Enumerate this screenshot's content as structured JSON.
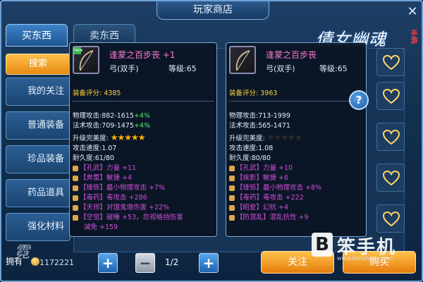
{
  "window": {
    "title": "玩家商店",
    "close_icon": "close-icon"
  },
  "logo": {
    "main": "倩女幽魂",
    "sub": "手游"
  },
  "tabs": [
    {
      "label": "买东西",
      "active": true
    },
    {
      "label": "卖东西",
      "active": false
    }
  ],
  "sidebar": {
    "search_label": "搜索",
    "items": [
      {
        "label": "我的关注"
      },
      {
        "label": "普通装备"
      },
      {
        "label": "珍品装备"
      },
      {
        "label": "药品道具"
      },
      {
        "label": "强化材料"
      }
    ]
  },
  "tooltip_left": {
    "badge": "new",
    "name": "逢蒙之百步丧 +1",
    "type": "弓(双手)",
    "level_label": "等级:65",
    "score_label": "装备评分:",
    "score": "4385",
    "phys_attack": "物理攻击:882-1615",
    "phys_bonus": "+4%",
    "magic_attack": "法术攻击:709-1475",
    "magic_bonus": "+4%",
    "perfection_label": "升级完美度:",
    "perfection_stars": 5,
    "attack_speed": "攻击速度:1.07",
    "durability": "耐久度:61/80",
    "gems": [
      {
        "text": "【孔武】力量 +11",
        "color": "#d04ed8"
      },
      {
        "text": "【奔雷】敏捷 +4",
        "color": "#d04ed8"
      },
      {
        "text": "【锋铄】最小物理攻击 +7%",
        "color": "#d04ed8"
      },
      {
        "text": "【毒药】毒攻击 +286",
        "color": "#d04ed8"
      },
      {
        "text": "【天师】对饿鬼增伤害 +22%",
        "color": "#d04ed8"
      },
      {
        "text": "【空觉】破睡 +53，忽视格挡伤害",
        "color": "#d04ed8"
      },
      {
        "text": "减免 +159",
        "color": "#d04ed8"
      }
    ]
  },
  "tooltip_right": {
    "name": "逢蒙之百步丧",
    "type": "弓(双手)",
    "level_label": "等级:65",
    "score_label": "装备评分:",
    "score": "3963",
    "phys_attack": "物理攻击:713-1999",
    "magic_attack": "法术攻击:565-1471",
    "perfection_label": "升级完美度:",
    "perfection_stars": 0,
    "attack_speed": "攻击速度:1.08",
    "durability": "耐久度:80/80",
    "gems": [
      {
        "text": "【孔武】力量 +10",
        "color": "#d04ed8"
      },
      {
        "text": "【疾影】敏捷 +6",
        "color": "#d04ed8"
      },
      {
        "text": "【锋铄】最小物理攻击 +8%",
        "color": "#d04ed8"
      },
      {
        "text": "【毒药】毒攻击 +222",
        "color": "#d04ed8"
      },
      {
        "text": "【昭奁】幻抗 +4",
        "color": "#d04ed8"
      },
      {
        "text": "【防混乱】混乱抗性 +9",
        "color": "#d04ed8"
      }
    ]
  },
  "help_icon_label": "?",
  "favorite_icons": [
    "heart-icon",
    "heart-icon",
    "heart-icon",
    "heart-icon",
    "heart-icon",
    "heart-icon"
  ],
  "bottom": {
    "money_label": "拥有",
    "money": "1172221",
    "page": "1/2",
    "plus_label": "+",
    "minus_label": "−",
    "follow_label": "关注",
    "buy_label": "购买"
  },
  "watermark": {
    "letter": "B",
    "text": "笨手机",
    "url": "www.benshouji.com"
  },
  "colors": {
    "accent_orange": "#f0a020",
    "gem_purple": "#d04ed8",
    "score_gold": "#ffd23a",
    "bonus_green": "#56e36a"
  }
}
